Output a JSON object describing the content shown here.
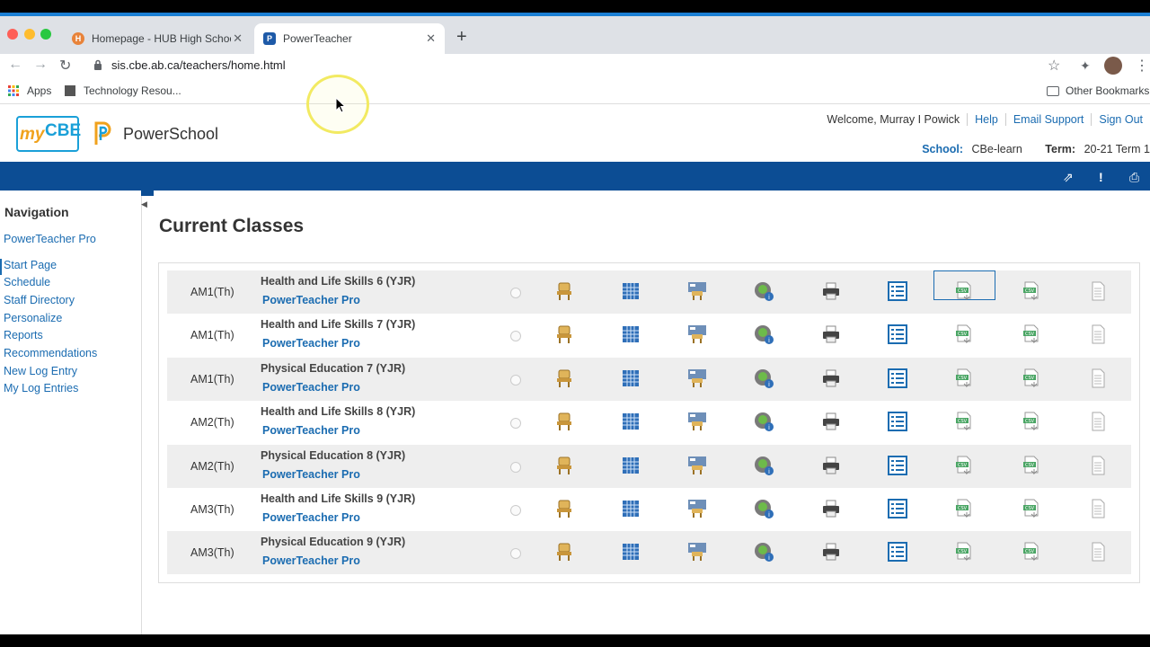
{
  "browser": {
    "tabs": [
      {
        "title": "Homepage - HUB High School",
        "favicon": "hub-icon",
        "active": false
      },
      {
        "title": "PowerTeacher",
        "favicon": "powerschool-icon",
        "active": true
      }
    ],
    "url": "sis.cbe.ab.ca/teachers/home.html",
    "bookmarks": [
      {
        "label": "Apps",
        "icon": "apps-grid-icon"
      },
      {
        "label": "Technology Resou...",
        "icon": "bookmark-icon"
      }
    ],
    "other_bookmarks": "Other Bookmarks"
  },
  "header": {
    "logo_my": "my",
    "logo_cbe": "CBE",
    "brand": "PowerSchool",
    "welcome": "Welcome, Murray I Powick",
    "help": "Help",
    "email_support": "Email Support",
    "sign_out": "Sign Out",
    "school_label": "School:",
    "school_value": "CBe-learn",
    "term_label": "Term:",
    "term_value": "20-21 Term 1"
  },
  "sidebar": {
    "heading": "Navigation",
    "pro_link": "PowerTeacher Pro",
    "items": [
      {
        "label": "Start Page",
        "active": true
      },
      {
        "label": "Schedule"
      },
      {
        "label": "Staff Directory"
      },
      {
        "label": "Personalize"
      },
      {
        "label": "Reports"
      },
      {
        "label": "Recommendations"
      },
      {
        "label": "New Log Entry"
      },
      {
        "label": "My Log Entries"
      }
    ]
  },
  "main": {
    "title": "Current Classes",
    "classes": [
      {
        "period": "AM1(Th)",
        "name": "Health and Life Skills 6 (YJR)",
        "link": "PowerTeacher Pro"
      },
      {
        "period": "AM1(Th)",
        "name": "Health and Life Skills 7 (YJR)",
        "link": "PowerTeacher Pro"
      },
      {
        "period": "AM1(Th)",
        "name": "Physical Education 7 (YJR)",
        "link": "PowerTeacher Pro"
      },
      {
        "period": "AM2(Th)",
        "name": "Health and Life Skills 8 (YJR)",
        "link": "PowerTeacher Pro"
      },
      {
        "period": "AM2(Th)",
        "name": "Physical Education 8 (YJR)",
        "link": "PowerTeacher Pro"
      },
      {
        "period": "AM3(Th)",
        "name": "Health and Life Skills 9 (YJR)",
        "link": "PowerTeacher Pro"
      },
      {
        "period": "AM3(Th)",
        "name": "Physical Education 9 (YJR)",
        "link": "PowerTeacher Pro"
      }
    ],
    "row_icons": [
      "attendance-chair-icon",
      "grid-table-icon",
      "seating-chart-icon",
      "student-info-icon",
      "printer-icon",
      "list-icon",
      "csv-export-icon",
      "csv-import-icon",
      "document-icon"
    ]
  },
  "colors": {
    "link": "#1b6cb1",
    "bluebar": "#0c4d94",
    "row_shade": "#eeeeee"
  }
}
